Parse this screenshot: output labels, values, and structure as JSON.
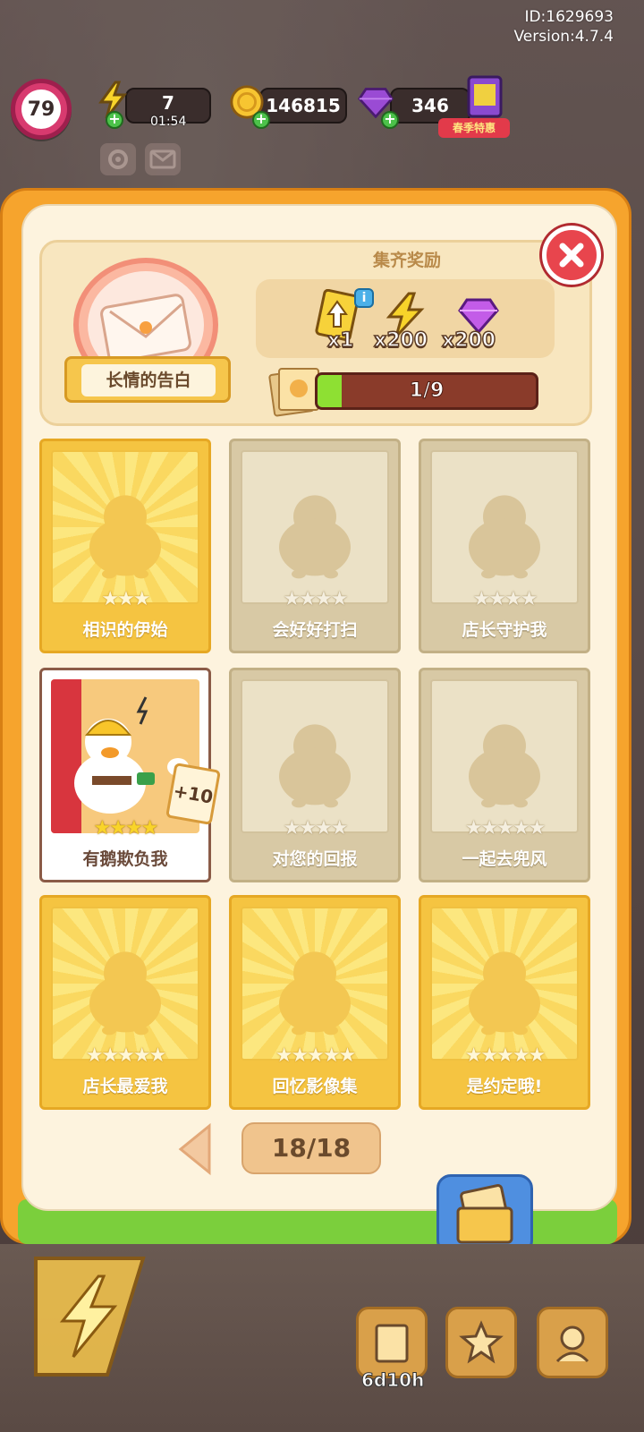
{
  "meta": {
    "id_label": "ID:1629693",
    "version_label": "Version:4.7.4"
  },
  "hud": {
    "level": "79",
    "energy": "7",
    "energy_timer": "01:54",
    "coins": "146815",
    "gems": "346",
    "promo_label": "春季特惠"
  },
  "album": {
    "set_name": "长情的告白",
    "reward_title": "集齐奖励",
    "rewards": [
      {
        "icon": "upgrade-card-icon",
        "qty": "x1"
      },
      {
        "icon": "energy-bolt-icon",
        "qty": "x200"
      },
      {
        "icon": "purple-gem-icon",
        "qty": "x200"
      }
    ],
    "progress_text": "1/9",
    "progress_fraction": 0.111,
    "cards": [
      {
        "title": "相识的伊始",
        "stars": "★★★",
        "state": "gold"
      },
      {
        "title": "会好好打扫",
        "stars": "★★★★",
        "state": "gray"
      },
      {
        "title": "店长守护我",
        "stars": "★★★★",
        "state": "gray"
      },
      {
        "title": "有鹅欺负我",
        "stars": "★★★★",
        "state": "owned"
      },
      {
        "title": "对您的回报",
        "stars": "★★★★",
        "state": "gray"
      },
      {
        "title": "一起去兜风",
        "stars": "★★★★★",
        "state": "gray"
      },
      {
        "title": "店长最爱我",
        "stars": "★★★★★",
        "state": "gold"
      },
      {
        "title": "回忆影像集",
        "stars": "★★★★★",
        "state": "gold"
      },
      {
        "title": "是约定哦!",
        "stars": "★★★★★",
        "state": "gold"
      }
    ],
    "owned_bonus": "+10",
    "page_indicator": "18/18"
  },
  "bottom": {
    "event_timer": "6d10h"
  },
  "colors": {
    "panel_orange": "#f6a42d",
    "card_gold": "#f5c441",
    "card_gray": "#d8c9a5",
    "close_red": "#e8454d",
    "progress_green": "#8ee033"
  }
}
